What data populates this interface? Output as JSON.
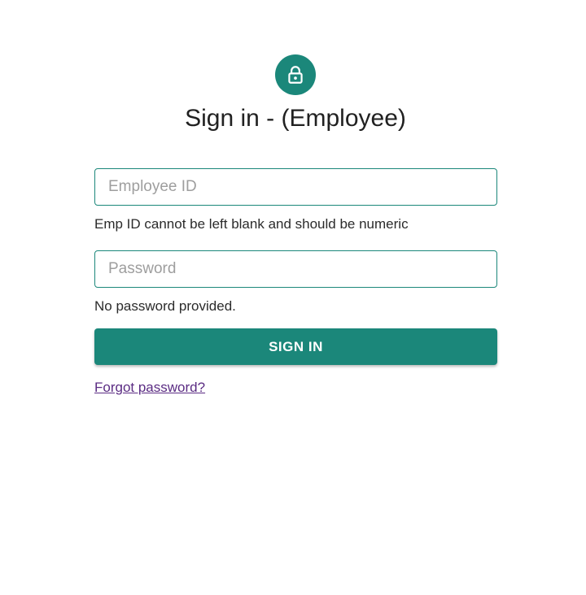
{
  "header": {
    "icon": "lock-icon",
    "title": "Sign in - (Employee)"
  },
  "form": {
    "employee_id": {
      "value": "",
      "placeholder": "Employee ID",
      "helper": "Emp ID cannot be left blank and should be numeric"
    },
    "password": {
      "value": "",
      "placeholder": "Password",
      "helper": "No password provided."
    },
    "submit_label": "SIGN IN",
    "forgot_label": "Forgot password?"
  },
  "colors": {
    "accent": "#1b877a",
    "link": "#5b2c83",
    "background": "#ffffff"
  }
}
